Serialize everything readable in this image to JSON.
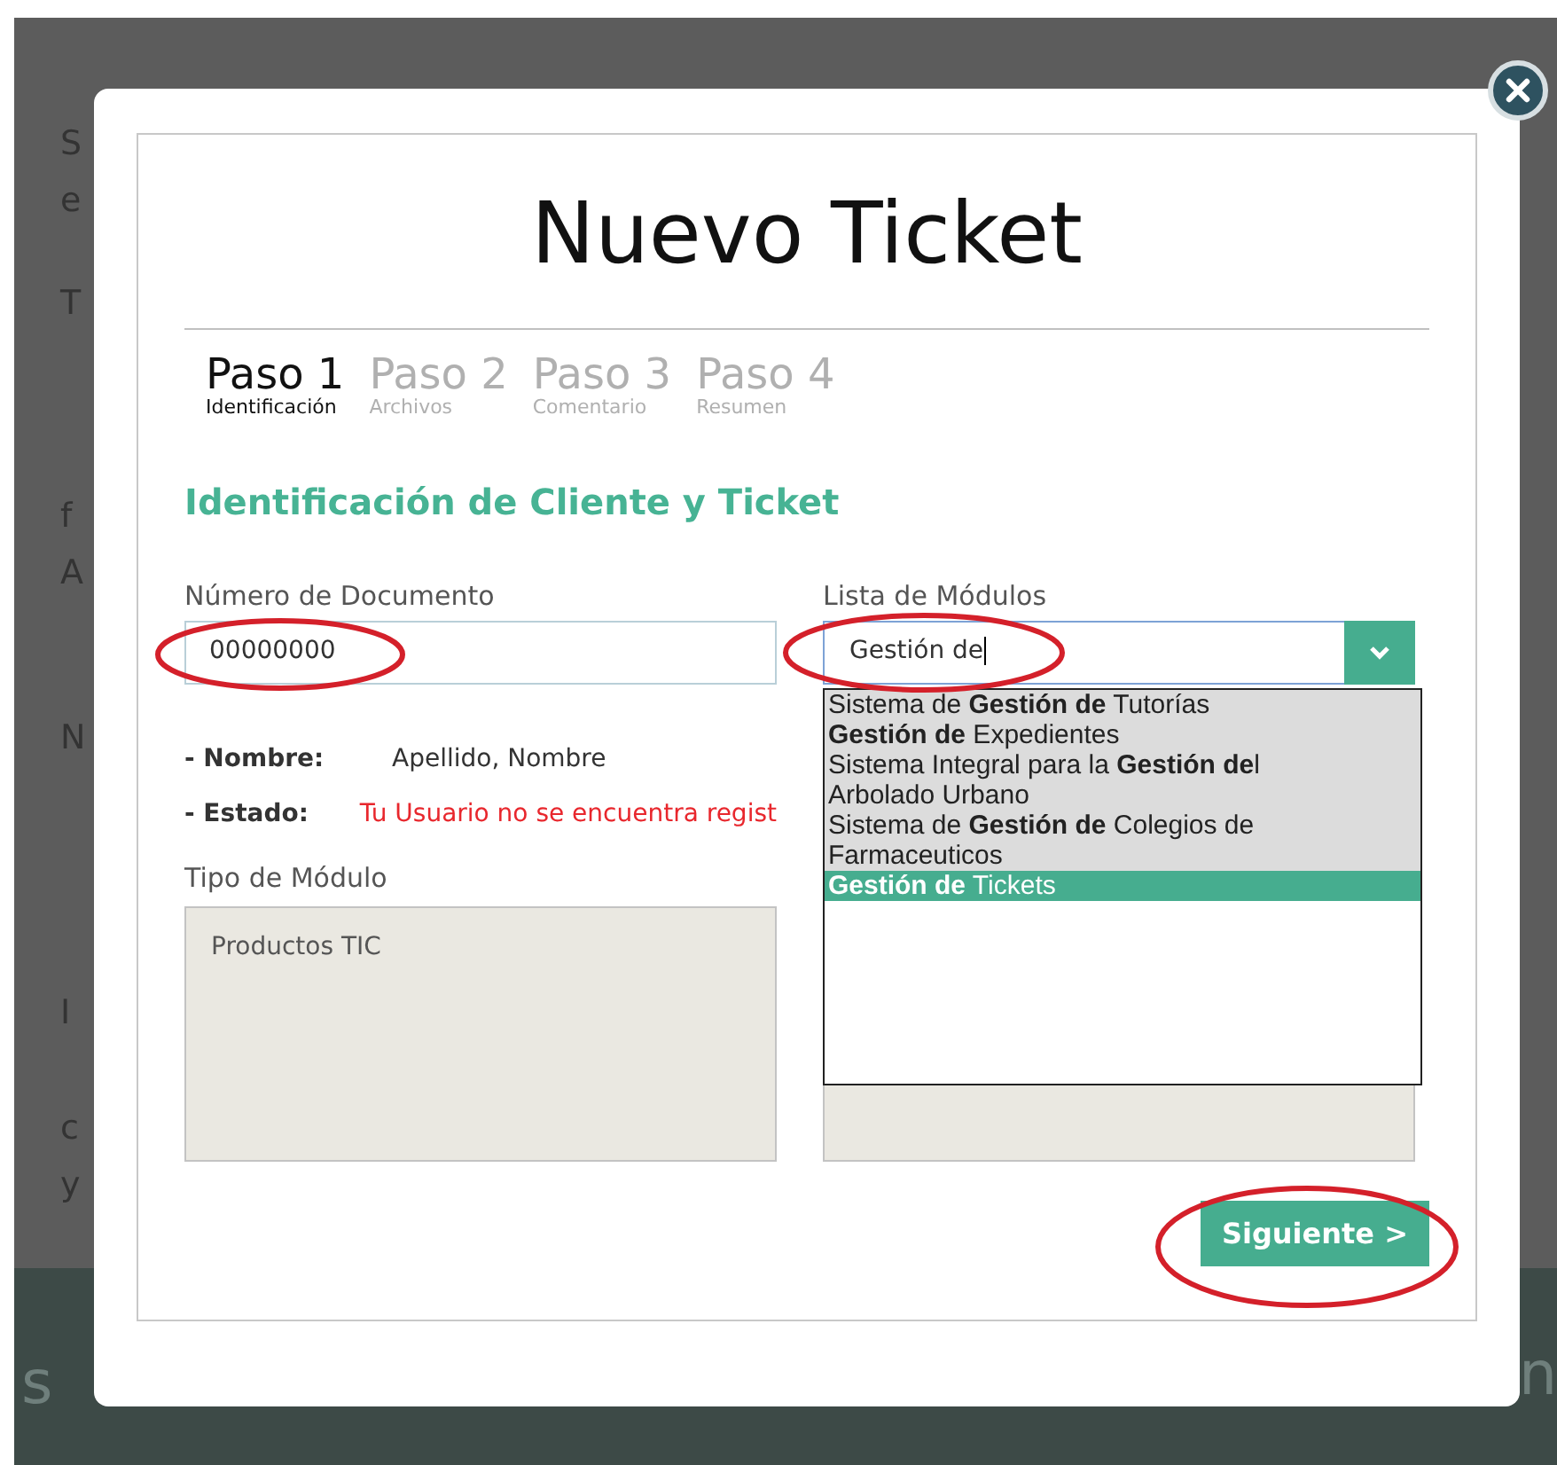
{
  "background": {
    "left_fragments": [
      "S",
      "e",
      "T",
      "f",
      "A",
      "N",
      "I",
      "c",
      "y"
    ],
    "band_fragments": [
      "s",
      "n"
    ]
  },
  "modal": {
    "title": "Nuevo Ticket",
    "steps": [
      {
        "label": "Paso 1",
        "sub": "Identificación",
        "selected": true
      },
      {
        "label": "Paso 2",
        "sub": "Archivos",
        "selected": false
      },
      {
        "label": "Paso 3",
        "sub": "Comentario",
        "selected": false
      },
      {
        "label": "Paso 4",
        "sub": "Resumen",
        "selected": false
      }
    ],
    "section_title": "Identificación de Cliente y Ticket",
    "document": {
      "label": "Número de Documento",
      "value": "00000000"
    },
    "modules": {
      "label": "Lista de Módulos",
      "value": "Gestión de",
      "options": [
        {
          "text": "Sistema de **Gestión de** Tutorías",
          "selected": false
        },
        {
          "text": "**Gestión de** Expedientes",
          "selected": false
        },
        {
          "text": "Sistema Integral para la **Gestión de**l Arbolado Urbano",
          "selected": false
        },
        {
          "text": "Sistema de **Gestión de** Colegios de Farmaceuticos",
          "selected": false
        },
        {
          "text": "**Gestión de** Tickets",
          "selected": true
        }
      ]
    },
    "info": [
      {
        "label": "- Nombre:",
        "value": "Apellido, Nombre",
        "kind": "normal"
      },
      {
        "label": "- Estado:",
        "value": "Tu Usuario no se encuentra regist",
        "kind": "error"
      }
    ],
    "module_type": {
      "label": "Tipo de Módulo",
      "value": "Productos TIC"
    },
    "next_button": "Siguiente >"
  }
}
